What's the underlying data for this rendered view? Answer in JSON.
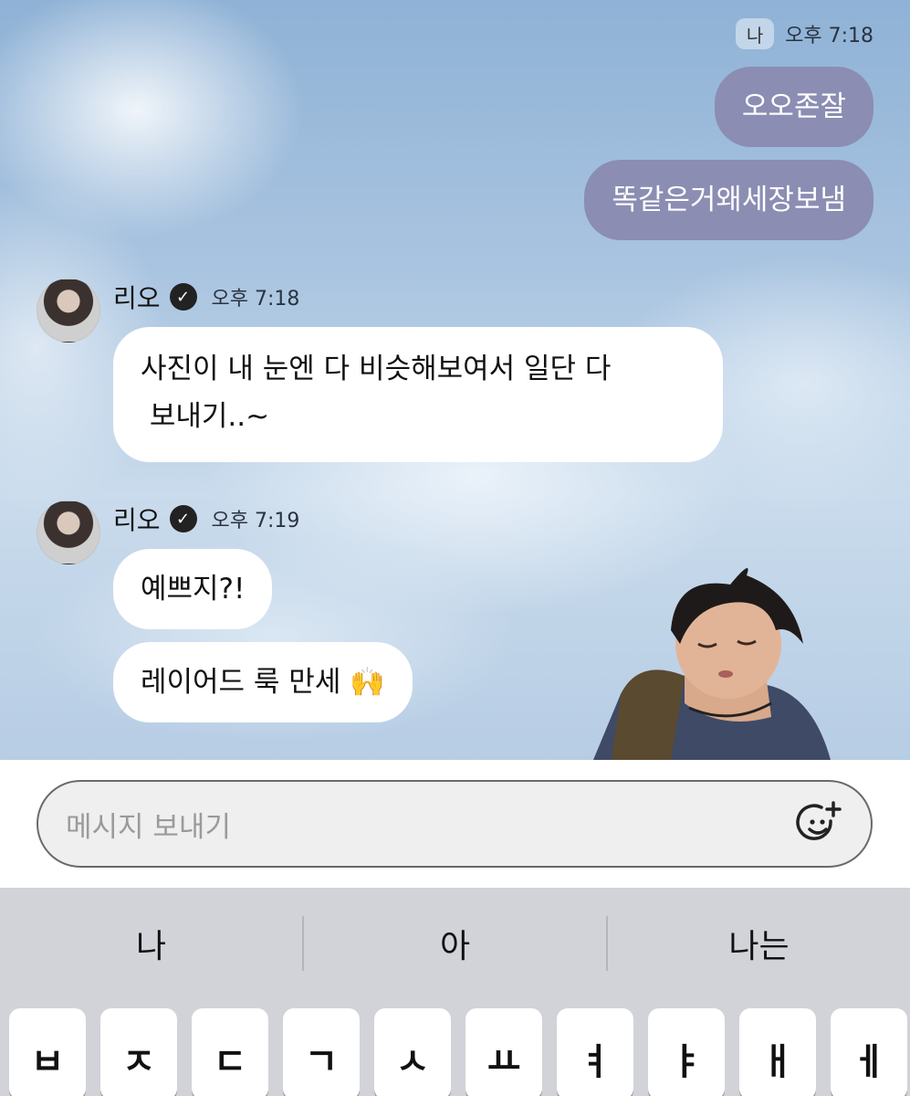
{
  "chat": {
    "me_badge": "나",
    "me_time": "오후 7:18",
    "my_messages": [
      "오오존잘",
      "똑같은거왜세장보냄"
    ],
    "groups": [
      {
        "sender": "리오",
        "time": "오후 7:18",
        "messages": [
          "사진이 내 눈엔 다 비슷해보여서 일단 다",
          " 보내기..~"
        ]
      },
      {
        "sender": "리오",
        "time": "오후 7:19",
        "messages": [
          "예쁘지?!",
          "레이어드 룩 만세 🙌"
        ]
      }
    ]
  },
  "input": {
    "placeholder": "메시지 보내기",
    "emoji_icon": "add-emoji-icon"
  },
  "keyboard": {
    "suggestions": [
      "나",
      "아",
      "나는"
    ],
    "keys": [
      "ㅂ",
      "ㅈ",
      "ㄷ",
      "ㄱ",
      "ㅅ",
      "ㅛ",
      "ㅕ",
      "ㅑ",
      "ㅐ",
      "ㅔ"
    ]
  },
  "colors": {
    "my_bubble": "#8b8db3",
    "their_bubble": "#ffffff",
    "keyboard_bg": "#d2d3d9"
  }
}
